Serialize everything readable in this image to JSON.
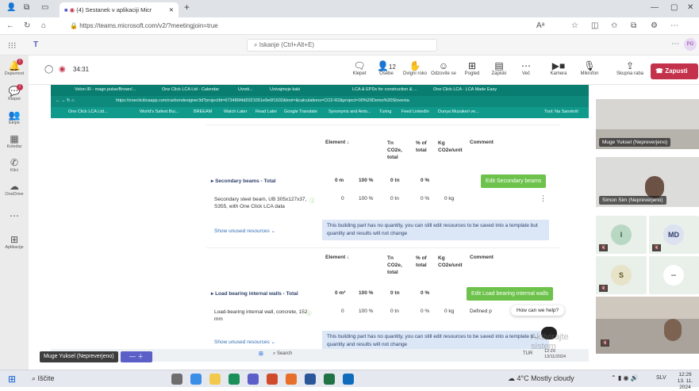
{
  "browser": {
    "tab_title": "(4) Sestanek v aplikaciji Micr",
    "new_tab": "+",
    "url": "https://teams.microsoft.com/v2/?meetingjoin=true"
  },
  "teams": {
    "search_placeholder": "Iskanje (Ctrl+Alt+E)",
    "timer": "34:31",
    "rail": [
      {
        "label": "Dejavnost"
      },
      {
        "label": "Klepet"
      },
      {
        "label": "Ekipe"
      },
      {
        "label": "Koledar"
      },
      {
        "label": "Klici"
      },
      {
        "label": "OneDrive"
      },
      {
        "label": "Aplikacije"
      }
    ],
    "controls": {
      "chat": "Klepet",
      "people": "Osebe",
      "people_count": "12",
      "raise": "Dvigni roko",
      "react": "Odzovite se",
      "view": "Pogled",
      "notes": "Zapiski",
      "more": "Več",
      "camera": "Kamera",
      "mic": "Mikrofon",
      "share": "Skupna raba",
      "leave": "Zapusti"
    }
  },
  "shared": {
    "tabs": [
      "Velon IR - magn.pulse/Brown/...",
      "One Click LCA Ltd - Calendar",
      "Uvrsti...",
      "Uzivajmoje kaki",
      "LCA & EPDs for construction & ...",
      "One Click LCA - LCA Made Easy"
    ],
    "url": "https://oneclicklcaapp.com/carbondesigner3d?projectId=673486f4d2021051e9e0f1502&tool=&calculations=CO2-R2&project=00%20Demo%20Slovenia",
    "bookmarks": [
      "One Click LCA Ltd...",
      "World's Safest Bui...",
      "BREEAM",
      "Watch Later",
      "Read Later",
      "Google Translate",
      "Synonyms and Anto...",
      "Turing",
      "Feed LinkedIn",
      "Dunya Muzakeri ve...",
      "Tool: Na Sanskriti"
    ],
    "header": {
      "element": "Element ↓",
      "value": "",
      "pct": "",
      "tn": "Tn CO2e, total",
      "pct_total": "% of total",
      "kg": "Kg CO2e/unit",
      "comment": "Comment"
    },
    "sections": [
      {
        "title": "Secondary beams - Total",
        "qty": "0 m",
        "pct": "100 %",
        "tn": "0 tn",
        "pct_total": "0 %",
        "button": "Edit Secondary beams",
        "item_name": "Secondary steel beam, UB 305x127x37, S355, with One Click LCA data",
        "item_qty": "0",
        "item_pct": "100 %",
        "item_tn": "0 tn",
        "item_pct_total": "0 %",
        "item_kg": "0 kg",
        "item_comment": "",
        "unused": "Show unused resources",
        "note": "This building part has no quantity, you can still edit resources to be saved into a template but quantity and results will not change"
      },
      {
        "title": "Load bearing internal walls - Total",
        "qty": "0 m²",
        "pct": "100 %",
        "tn": "0 tn",
        "pct_total": "0 %",
        "button": "Edit Load bearing internal walls",
        "item_name": "Load-bearing internal wall, concrete, 152 mm",
        "item_qty": "0",
        "item_pct": "100 %",
        "item_tn": "0 tn",
        "item_pct_total": "0 %",
        "item_kg": "0 kg",
        "item_comment": "Defined p",
        "unused": "Show unused resources",
        "note": "This building part has no quantity, you can still edit resources to be saved into a template b... quantity and results will not change"
      }
    ],
    "help": "How can we help?"
  },
  "participants": [
    {
      "name": "Muge Yuksel (Nepreverjeno)"
    },
    {
      "name": "Simon Sim (Nepreverjeno)"
    },
    {
      "initial": "I"
    },
    {
      "initial": "MD"
    },
    {
      "initial": "S"
    }
  ],
  "presenter_pill": "Muge Yuksel (Nepreverjeno)",
  "activate_watermark": "Aktivirajte sistem",
  "taskbar": {
    "search": "Iščite",
    "weather": "4°C Mostly cloudy",
    "lang": "SLV",
    "time": "12:29",
    "date": "13. 11. 2024",
    "inner_time": "12:29",
    "inner_date": "13/11/2024",
    "inner_lang": "TUR"
  }
}
